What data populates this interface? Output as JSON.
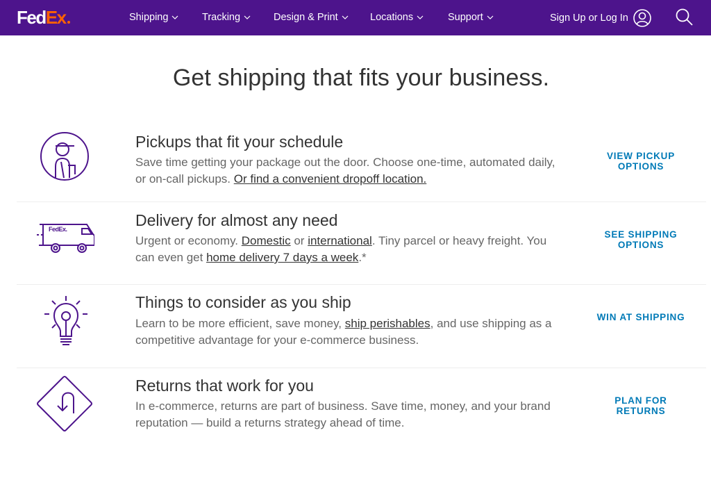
{
  "brand": {
    "fed": "Fed",
    "ex": "Ex",
    "primary_color": "#4d148c",
    "accent_color": "#ff6200",
    "link_color": "#007ab7"
  },
  "nav": {
    "items": [
      {
        "label": "Shipping"
      },
      {
        "label": "Tracking"
      },
      {
        "label": "Design & Print"
      },
      {
        "label": "Locations"
      },
      {
        "label": "Support"
      }
    ],
    "signin_label": "Sign Up or Log In",
    "signin_icon": "user-circle-icon",
    "search_icon": "search-icon"
  },
  "headline": "Get shipping that fits your business.",
  "features": [
    {
      "icon": "courier-person-icon",
      "title": "Pickups that fit your schedule",
      "desc_parts": [
        {
          "text": "Save time getting your package out the door. Choose one-time, automated daily, or on-call pickups. "
        },
        {
          "link": "Or find a convenient dropoff location."
        }
      ],
      "cta": "View Pickup Options"
    },
    {
      "icon": "delivery-truck-icon",
      "title": "Delivery for almost any need",
      "desc_parts": [
        {
          "text": "Urgent or economy. "
        },
        {
          "link": "Domestic"
        },
        {
          "text": " or "
        },
        {
          "link": "international"
        },
        {
          "text": ". Tiny parcel or heavy freight. You can even get "
        },
        {
          "link": "home delivery 7 days a week"
        },
        {
          "text": ".*"
        }
      ],
      "cta": "See Shipping Options"
    },
    {
      "icon": "lightbulb-icon",
      "title": "Things to consider as you ship",
      "desc_parts": [
        {
          "text": "Learn to be more efficient, save money, "
        },
        {
          "link": "ship perishables"
        },
        {
          "text": ", and use shipping as a competitive advantage for your e-commerce business."
        }
      ],
      "cta": "Win at Shipping"
    },
    {
      "icon": "u-turn-sign-icon",
      "title": "Returns that work for you",
      "desc_parts": [
        {
          "text": "In e-commerce, returns are part of business. Save time, money, and your brand reputation — build a returns strategy ahead of time."
        }
      ],
      "cta": "Plan for Returns"
    }
  ]
}
